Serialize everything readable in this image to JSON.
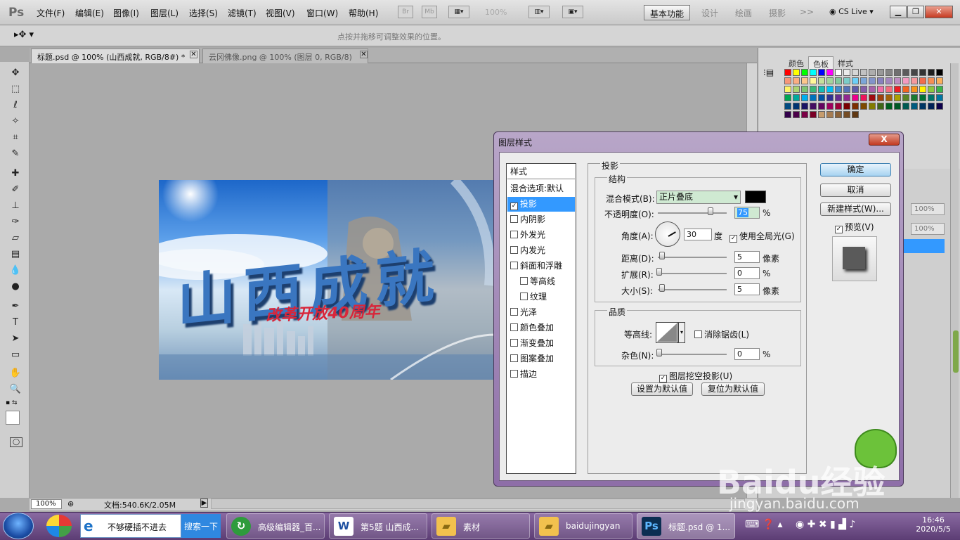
{
  "app": {
    "logo": "Ps"
  },
  "menu": [
    "文件(F)",
    "编辑(E)",
    "图像(I)",
    "图层(L)",
    "选择(S)",
    "滤镜(T)",
    "视图(V)",
    "窗口(W)",
    "帮助(H)"
  ],
  "toolbar": {
    "br": "Br",
    "mb": "Mb",
    "zoom": "100%"
  },
  "workspaces": [
    "基本功能",
    "设计",
    "绘画",
    "摄影"
  ],
  "workspace_more": ">>",
  "cslive": "CS Live",
  "options_hint": "点按并拖移可调整效果的位置。",
  "doc_tabs": [
    "标题.psd @ 100% (山西成就, RGB/8#) *",
    "云冈佛像.png @ 100% (图层 0, RGB/8)"
  ],
  "status": {
    "zoom": "100%",
    "doc": "文档:540.6K/2.05M"
  },
  "artwork": {
    "title": "山西成就",
    "subtitle": "改革开放40周年"
  },
  "swatch_tabs": [
    "颜色",
    "色板",
    "样式"
  ],
  "swatch_colors": [
    "#ff0000",
    "#ffff00",
    "#00ff00",
    "#00ffff",
    "#0000ff",
    "#ff00ff",
    "#ffffff",
    "#ebebeb",
    "#d6d6d6",
    "#c2c2c2",
    "#adadad",
    "#999999",
    "#858585",
    "#707070",
    "#5c5c5c",
    "#474747",
    "#333333",
    "#1f1f1f",
    "#000000",
    "#f7977a",
    "#fbad82",
    "#fdc68c",
    "#fff799",
    "#c6df9c",
    "#a4d49d",
    "#81ca9d",
    "#7bcdc8",
    "#6ccff7",
    "#7ca6d8",
    "#8293ca",
    "#8881be",
    "#a286bd",
    "#bc8cbf",
    "#f49bc1",
    "#f5999d",
    "#f16c4d",
    "#f68e54",
    "#fbaf5a",
    "#fff467",
    "#acd372",
    "#7dc473",
    "#39b778",
    "#16bcb4",
    "#00bff3",
    "#438ccb",
    "#5573b7",
    "#5e5ca7",
    "#855fa8",
    "#a763a9",
    "#ef6ea8",
    "#f16d7e",
    "#ed1c24",
    "#f26522",
    "#f7941d",
    "#fff200",
    "#8dc63f",
    "#39b54a",
    "#00a651",
    "#00a99d",
    "#00aeef",
    "#0072bc",
    "#0054a5",
    "#2e3192",
    "#662d91",
    "#92278f",
    "#ec008c",
    "#ed145b",
    "#9e0b0f",
    "#a0410d",
    "#a3620a",
    "#aba000",
    "#598527",
    "#197b30",
    "#007236",
    "#00746b",
    "#0076a3",
    "#004a80",
    "#003471",
    "#1b1464",
    "#440e62",
    "#630460",
    "#9e005d",
    "#9e0039",
    "#790000",
    "#7b2e00",
    "#7d4900",
    "#827b00",
    "#406618",
    "#005e20",
    "#005826",
    "#005952",
    "#005b7f",
    "#003663",
    "#002157",
    "#0d004c",
    "#32004b",
    "#4b0049",
    "#7b0046",
    "#7a0026",
    "#c69c6d",
    "#a67c52",
    "#8c6239",
    "#754c24",
    "#603813"
  ],
  "layers": {
    "opacity_label": "100%",
    "fill_label": "100%"
  },
  "dialog": {
    "title": "图层样式",
    "close": "X",
    "styles_header": "样式",
    "blend_options": "混合选项:默认",
    "styles": [
      {
        "label": "投影",
        "checked": true,
        "selected": true,
        "indent": false
      },
      {
        "label": "内阴影",
        "checked": false,
        "selected": false,
        "indent": false
      },
      {
        "label": "外发光",
        "checked": false,
        "selected": false,
        "indent": false
      },
      {
        "label": "内发光",
        "checked": false,
        "selected": false,
        "indent": false
      },
      {
        "label": "斜面和浮雕",
        "checked": false,
        "selected": false,
        "indent": false
      },
      {
        "label": "等高线",
        "checked": false,
        "selected": false,
        "indent": true
      },
      {
        "label": "纹理",
        "checked": false,
        "selected": false,
        "indent": true
      },
      {
        "label": "光泽",
        "checked": false,
        "selected": false,
        "indent": false
      },
      {
        "label": "颜色叠加",
        "checked": false,
        "selected": false,
        "indent": false
      },
      {
        "label": "渐变叠加",
        "checked": false,
        "selected": false,
        "indent": false
      },
      {
        "label": "图案叠加",
        "checked": false,
        "selected": false,
        "indent": false
      },
      {
        "label": "描边",
        "checked": false,
        "selected": false,
        "indent": false
      }
    ],
    "section_title": "投影",
    "structure": {
      "title": "结构",
      "blend_mode_label": "混合模式(B):",
      "blend_mode_value": "正片叠底",
      "opacity_label": "不透明度(O):",
      "opacity_value": "75",
      "percent": "%",
      "angle_label": "角度(A):",
      "angle_value": "30",
      "degree": "度",
      "global_light_label": "使用全局光(G)",
      "global_light": true,
      "distance_label": "距离(D):",
      "distance_value": "5",
      "spread_label": "扩展(R):",
      "spread_value": "0",
      "size_label": "大小(S):",
      "size_value": "5",
      "px": "像素"
    },
    "quality": {
      "title": "品质",
      "contour_label": "等高线:",
      "antialias_label": "消除锯齿(L)",
      "noise_label": "杂色(N):",
      "noise_value": "0",
      "percent": "%"
    },
    "knockout_label": "图层挖空投影(U)",
    "set_default": "设置为默认值",
    "reset_default": "复位为默认值",
    "ok": "确定",
    "cancel": "取消",
    "new_style": "新建样式(W)...",
    "preview_label": "预览(V)"
  },
  "taskbar": {
    "ie_text": "不够硬插不进去",
    "search_btn": "搜索一下",
    "items": [
      "高级编辑器_百...",
      "第5题 山西成...",
      "素材",
      "baidujingyan",
      "标题.psd @ 1..."
    ],
    "time": "16:46",
    "date": "2020/5/5"
  },
  "watermark": {
    "brand": "Baidu经验",
    "url": "jingyan.baidu.com"
  }
}
